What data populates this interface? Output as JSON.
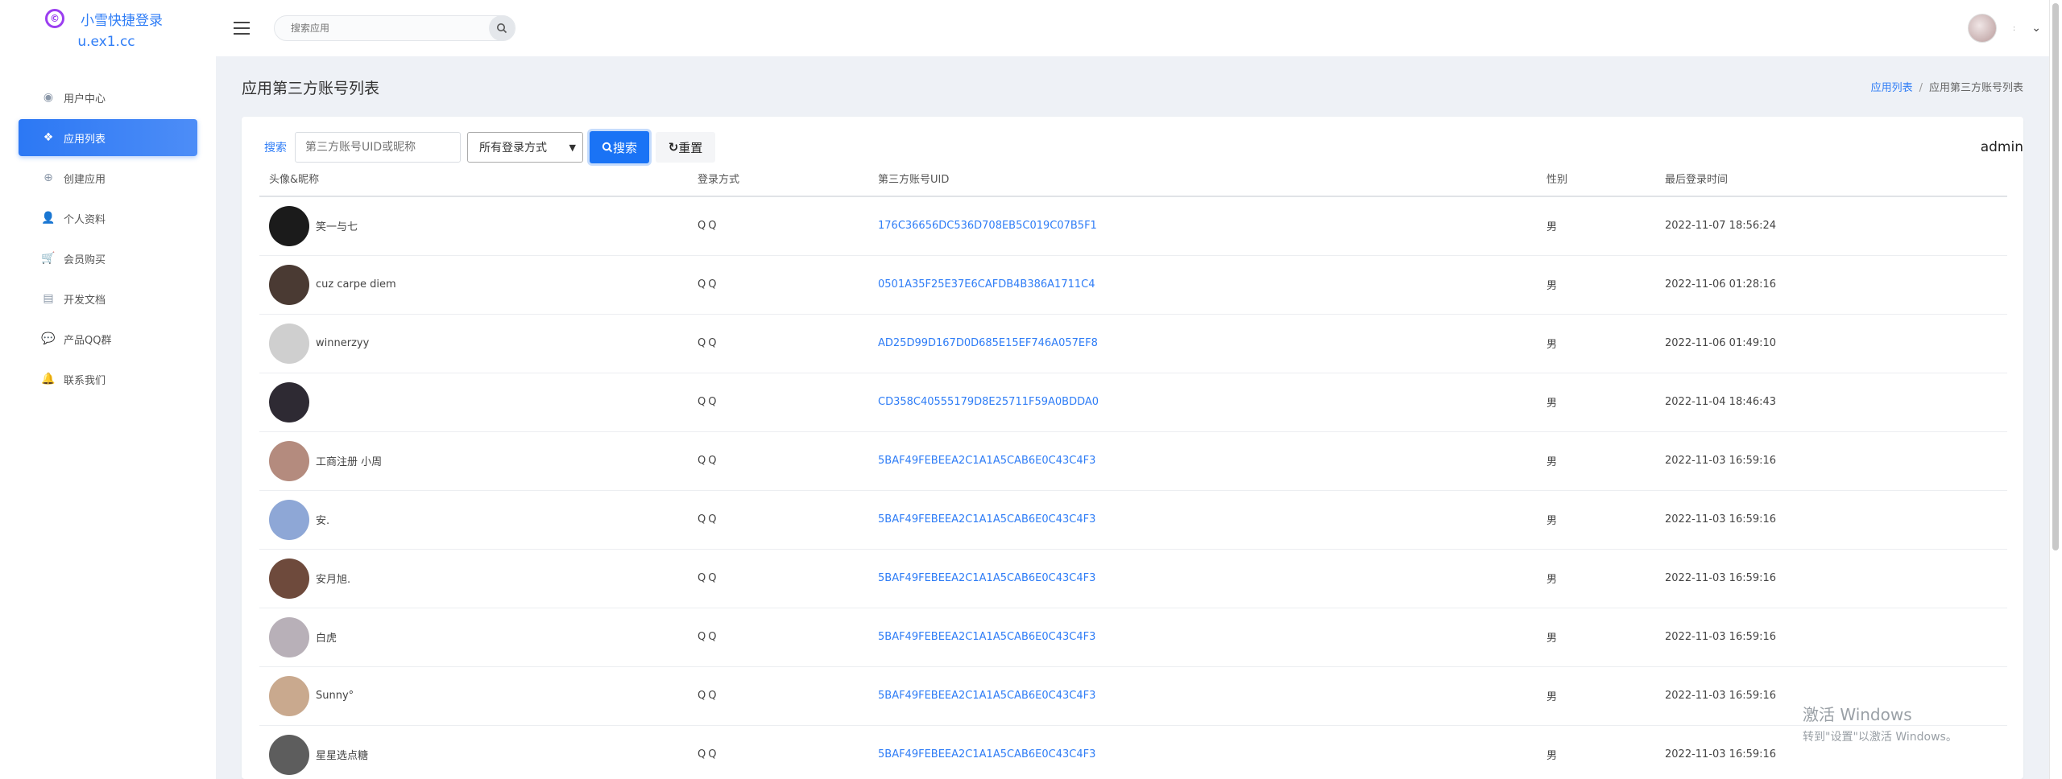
{
  "brand": {
    "name": "小雪快捷登录",
    "domain": "u.ex1.cc",
    "logo_glyph": "©",
    "logo_color": "#9b3ef0"
  },
  "topbar": {
    "search_placeholder": "搜索应用"
  },
  "sidebar": {
    "items": [
      {
        "label": "用户中心",
        "icon": "user-circle-icon",
        "glyph": "◉",
        "active": false
      },
      {
        "label": "应用列表",
        "icon": "apps-icon",
        "glyph": "❖",
        "active": true
      },
      {
        "label": "创建应用",
        "icon": "plus-circle-icon",
        "glyph": "⊕",
        "active": false
      },
      {
        "label": "个人资料",
        "icon": "user-settings-icon",
        "glyph": "👤",
        "active": false
      },
      {
        "label": "会员购买",
        "icon": "cart-icon",
        "glyph": "🛒",
        "active": false
      },
      {
        "label": "开发文档",
        "icon": "document-icon",
        "glyph": "▤",
        "active": false
      },
      {
        "label": "产品QQ群",
        "icon": "chat-icon",
        "glyph": "💬",
        "active": false
      },
      {
        "label": "联系我们",
        "icon": "bell-icon",
        "glyph": "🔔",
        "active": false
      }
    ]
  },
  "page": {
    "title": "应用第三方账号列表",
    "breadcrumb": {
      "link": "应用列表",
      "separator": "/",
      "current": "应用第三方账号列表"
    }
  },
  "filter": {
    "label": "搜索",
    "input_placeholder": "第三方账号UID或昵称",
    "select_value": "所有登录方式",
    "search_button": "搜索",
    "reset_button": "重置"
  },
  "admin_label": "admin",
  "table": {
    "headers": [
      "头像&昵称",
      "登录方式",
      "第三方账号UID",
      "性别",
      "最后登录时间"
    ],
    "rows": [
      {
        "nickname": "笑一与七",
        "method": "QQ",
        "uid": "176C36656DC536D708EB5C019C07B5F1",
        "gender": "男",
        "last_login": "2022-11-07 18:56:24",
        "avatar_color": "#1b1b1b"
      },
      {
        "nickname": "cuz carpe diem",
        "method": "QQ",
        "uid": "0501A35F25E37E6CAFDB4B386A1711C4",
        "gender": "男",
        "last_login": "2022-11-06 01:28:16",
        "avatar_color": "#4a3a33"
      },
      {
        "nickname": "winnerzyy",
        "method": "QQ",
        "uid": "AD25D99D167D0D685E15EF746A057EF8",
        "gender": "男",
        "last_login": "2022-11-06 01:49:10",
        "avatar_color": "#cfcfcf"
      },
      {
        "nickname": "",
        "method": "QQ",
        "uid": "CD358C40555179D8E25711F59A0BDDA0",
        "gender": "男",
        "last_login": "2022-11-04 18:46:43",
        "avatar_color": "#2e2a33"
      },
      {
        "nickname": "工商注册 小周",
        "method": "QQ",
        "uid": "5BAF49FEBEEA2C1A1A5CAB6E0C43C4F3",
        "gender": "男",
        "last_login": "2022-11-03 16:59:16",
        "avatar_color": "#b48b7e"
      },
      {
        "nickname": "安.",
        "method": "QQ",
        "uid": "5BAF49FEBEEA2C1A1A5CAB6E0C43C4F3",
        "gender": "男",
        "last_login": "2022-11-03 16:59:16",
        "avatar_color": "#8ea7d6"
      },
      {
        "nickname": "安月旭.",
        "method": "QQ",
        "uid": "5BAF49FEBEEA2C1A1A5CAB6E0C43C4F3",
        "gender": "男",
        "last_login": "2022-11-03 16:59:16",
        "avatar_color": "#6e4a3c"
      },
      {
        "nickname": "白虎",
        "method": "QQ",
        "uid": "5BAF49FEBEEA2C1A1A5CAB6E0C43C4F3",
        "gender": "男",
        "last_login": "2022-11-03 16:59:16",
        "avatar_color": "#b8b0b8"
      },
      {
        "nickname": "Sunny°",
        "method": "QQ",
        "uid": "5BAF49FEBEEA2C1A1A5CAB6E0C43C4F3",
        "gender": "男",
        "last_login": "2022-11-03 16:59:16",
        "avatar_color": "#c9a98e"
      },
      {
        "nickname": "星星选点糖",
        "method": "QQ",
        "uid": "5BAF49FEBEEA2C1A1A5CAB6E0C43C4F3",
        "gender": "男",
        "last_login": "2022-11-03 16:59:16",
        "avatar_color": "#5d5d5d"
      }
    ]
  },
  "watermark": {
    "line1": "激活 Windows",
    "line2": "转到\"设置\"以激活 Windows。"
  }
}
